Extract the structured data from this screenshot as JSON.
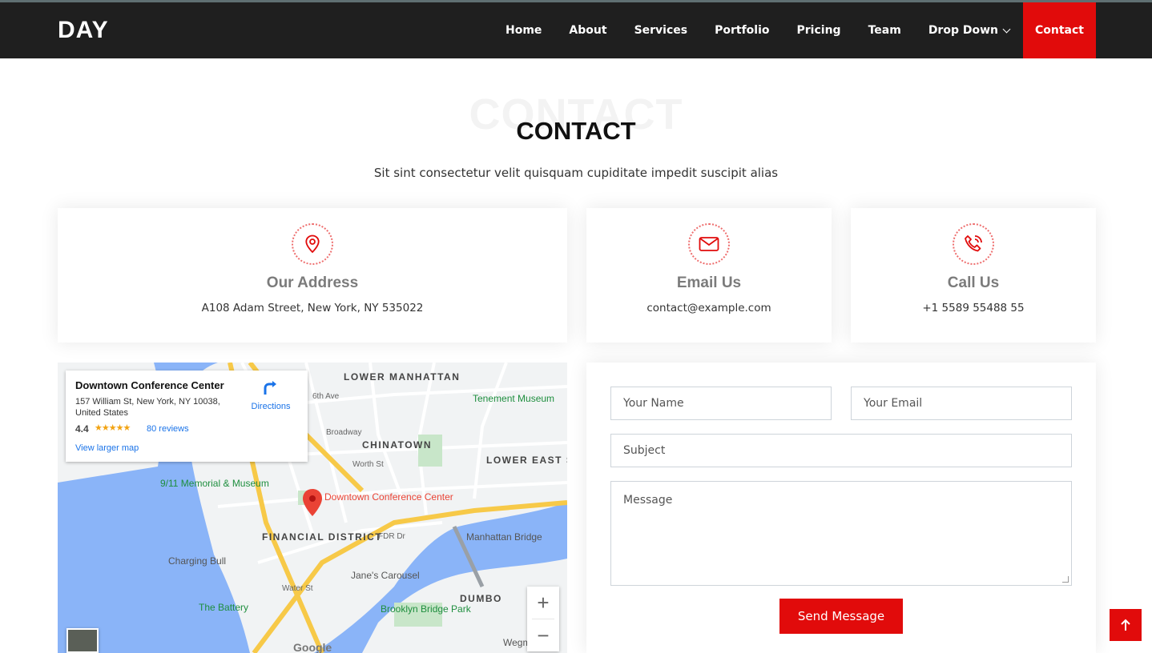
{
  "header": {
    "logo": "DAY",
    "nav": [
      {
        "label": "Home"
      },
      {
        "label": "About"
      },
      {
        "label": "Services"
      },
      {
        "label": "Portfolio"
      },
      {
        "label": "Pricing"
      },
      {
        "label": "Team"
      },
      {
        "label": "Drop Down"
      },
      {
        "label": "Contact",
        "active": true
      }
    ]
  },
  "section": {
    "bg_title": "CONTACT",
    "title": "CONTACT",
    "subtitle": "Sit sint consectetur velit quisquam cupiditate impedit suscipit alias"
  },
  "cards": [
    {
      "icon": "map-pin-icon",
      "title": "Our Address",
      "text": "A108 Adam Street, New York, NY 535022"
    },
    {
      "icon": "envelope-icon",
      "title": "Email Us",
      "text": "contact@example.com"
    },
    {
      "icon": "phone-icon",
      "title": "Call Us",
      "text": "+1 5589 55488 55"
    }
  ],
  "map": {
    "place_name": "Downtown Conference Center",
    "address": "157 William St, New York, NY 10038, United States",
    "rating": "4.4",
    "stars": "★★★★★",
    "reviews": "80 reviews",
    "directions": "Directions",
    "larger_map": "View larger map",
    "pin_label": "Downtown Conference Center",
    "labels": {
      "lower_manhattan": "LOWER MANHATTAN",
      "chinatown": "CHINATOWN",
      "lower_east_side": "LOWER EAST SIDE",
      "financial_district": "FINANCIAL DISTRICT",
      "tenement": "Tenement Museum",
      "memorial": "9/11 Memorial & Museum",
      "manhattan_bridge": "Manhattan Bridge",
      "charging_bull": "Charging Bull",
      "janes_carousel": "Jane's Carousel",
      "dumbo": "DUMBO",
      "the_battery": "The Battery",
      "brooklyn_bridge_park": "Brooklyn Bridge Park",
      "fdr": "FDR Dr",
      "broadway": "Broadway",
      "worth": "Worth St",
      "water": "Water St",
      "sixth_ave": "6th Ave",
      "weg": "Wegm"
    },
    "google": "Google"
  },
  "form": {
    "name_placeholder": "Your Name",
    "email_placeholder": "Your Email",
    "subject_placeholder": "Subject",
    "message_placeholder": "Message",
    "submit": "Send Message"
  },
  "colors": {
    "accent": "#e10b0b",
    "header_bg": "#1f1f1f"
  }
}
